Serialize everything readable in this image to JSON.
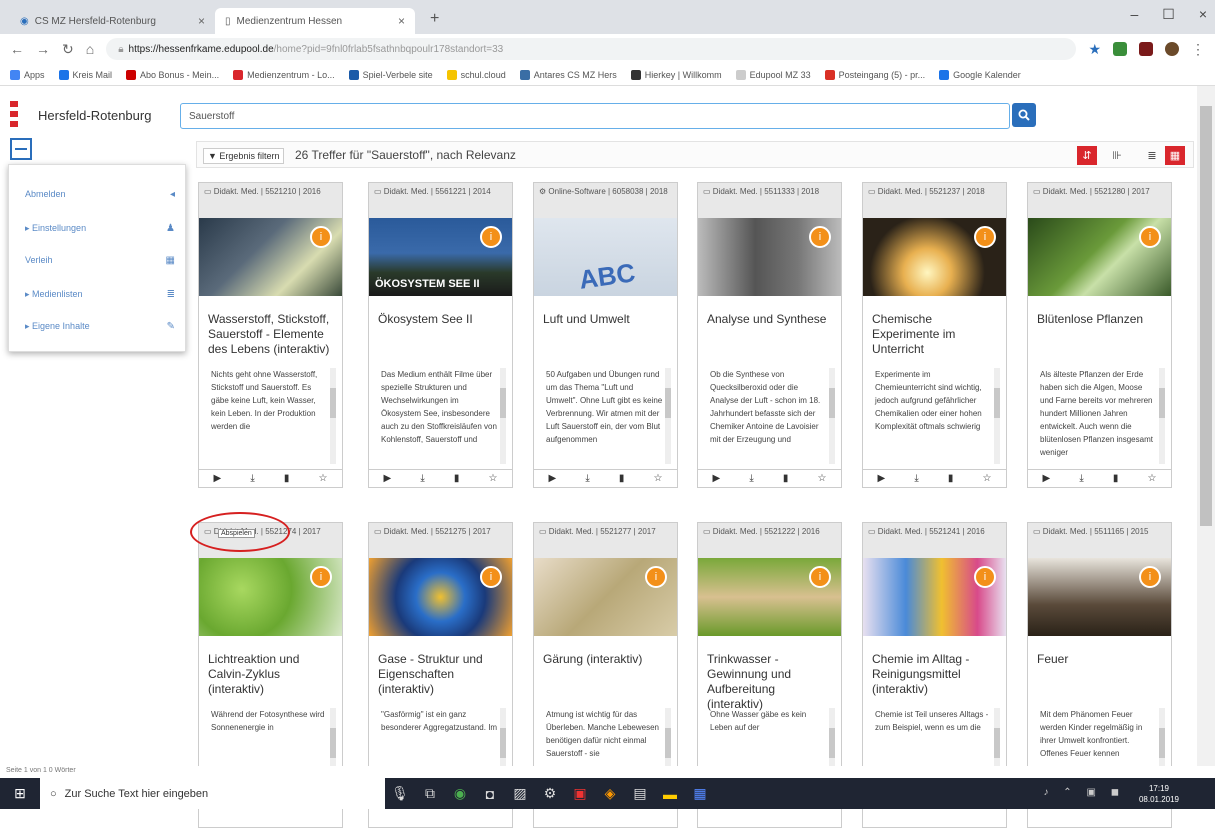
{
  "browser": {
    "tabs": [
      {
        "label": "CS MZ Hersfeld-Rotenburg"
      },
      {
        "label": "Medienzentrum Hessen"
      }
    ],
    "url_host": "https://hessenfrkame.edupool.de",
    "url_rest": "/home?pid=9fnl0frlab5fsathnbqpoulr178standort=33",
    "bookmarks": [
      "Apps",
      "Kreis Mail",
      "Abo Bonus - Mein...",
      "Medienzentrum - Lo...",
      "Spiel-Verbele site",
      "schul.cloud",
      "Antares CS MZ Hers",
      "Hierkey | Willkomm",
      "Edupool MZ 33",
      "Posteingang (5) - pr...",
      "Google Kalender"
    ]
  },
  "header": {
    "region": "Hersfeld-Rotenburg",
    "search_value": "Sauerstoff"
  },
  "sidemenu": [
    {
      "label": "Abmelden",
      "icon": "logout-icon"
    },
    {
      "label": "Einstellungen",
      "icon": "user-icon"
    },
    {
      "label": "Verleih",
      "icon": "calendar-icon"
    },
    {
      "label": "Medienlisten",
      "icon": "list-icon"
    },
    {
      "label": "Eigene Inhalte",
      "icon": "edit-icon"
    }
  ],
  "results": {
    "filter_label": "Ergebnis filtern",
    "summary": "26 Treffer für \"Sauerstoff\", nach Relevanz"
  },
  "cards": [
    {
      "meta": "Didakt. Med. | 5521210 | 2016",
      "title": "Wasserstoff, Stickstoff, Sauerstoff - Elemente des Lebens (interaktiv)",
      "desc": "Nichts geht ohne Wasserstoff, Stickstoff und Sauerstoff. Es gäbe keine Luft, kein Wasser, kein Leben. In der Produktion werden die"
    },
    {
      "meta": "Didakt. Med. | 5561221 | 2014",
      "title": "Ökosystem See II",
      "desc": "Das Medium enthält Filme über spezielle Strukturen und Wechselwirkungen im Ökosystem See, insbesondere auch zu den Stoffkreisläufen von Kohlenstoff, Sauerstoff und"
    },
    {
      "meta": "Online-Software | 6058038 | 2018",
      "title": "Luft und Umwelt",
      "desc": "50 Aufgaben und Übungen rund um das Thema \"Luft und Umwelt\". Ohne Luft gibt es keine Verbrennung. Wir atmen mit der Luft Sauerstoff ein, der vom Blut aufgenommen"
    },
    {
      "meta": "Didakt. Med. | 5511333 | 2018",
      "title": "Analyse und Synthese",
      "desc": "Ob die Synthese von Quecksilberoxid oder die Analyse der Luft - schon im 18. Jahrhundert befasste sich der Chemiker Antoine de Lavoisier mit der Erzeugung und"
    },
    {
      "meta": "Didakt. Med. | 5521237 | 2018",
      "title": "Chemische Experimente im Unterricht",
      "desc": "Experimente im Chemieunterricht sind wichtig, jedoch aufgrund gefährlicher Chemikalien oder einer hohen Komplexität oftmals schwierig"
    },
    {
      "meta": "Didakt. Med. | 5521280 | 2017",
      "title": "Blütenlose Pflanzen",
      "desc": "Als älteste Pflanzen der Erde haben sich die Algen, Moose und Farne bereits vor mehreren hundert Millionen Jahren entwickelt. Auch wenn die blütenlosen Pflanzen insgesamt weniger"
    },
    {
      "meta": "Didakt. Med. | 5521274 | 2017",
      "title": "Lichtreaktion und Calvin-Zyklus (interaktiv)",
      "desc": "Während der Fotosynthese wird Sonnenenergie in"
    },
    {
      "meta": "Didakt. Med. | 5521275 | 2017",
      "title": "Gase - Struktur und Eigenschaften (interaktiv)",
      "desc": "\"Gasförmig\" ist ein ganz besonderer Aggregatzustand. Im"
    },
    {
      "meta": "Didakt. Med. | 5521277 | 2017",
      "title": "Gärung (interaktiv)",
      "desc": "Atmung ist wichtig für das Überleben. Manche Lebewesen benötigen dafür nicht einmal Sauerstoff - sie"
    },
    {
      "meta": "Didakt. Med. | 5521222 | 2016",
      "title": "Trinkwasser - Gewinnung und Aufbereitung (interaktiv)",
      "desc": "Ohne Wasser gäbe es kein Leben auf der"
    },
    {
      "meta": "Didakt. Med. | 5521241 | 2016",
      "title": "Chemie im Alltag - Reinigungsmittel (interaktiv)",
      "desc": "Chemie ist Teil unseres Alltags - zum Beispiel, wenn es um die"
    },
    {
      "meta": "Didakt. Med. | 5511165 | 2015",
      "title": "Feuer",
      "desc": "Mit dem Phänomen Feuer werden Kinder regelmäßig in ihrer Umwelt konfrontiert. Offenes Feuer kennen"
    }
  ],
  "card_overlay_text": "ÖKOSYSTEM SEE II",
  "card_abc_text": "ABC",
  "tooltip": "Abspielen",
  "statusbar": "Seite 1 von 1    0 Wörter",
  "taskbar": {
    "search_placeholder": "Zur Suche Text hier eingeben",
    "time": "17:19",
    "date": "08.01.2019"
  },
  "colors": {
    "accent": "#2a6ebb",
    "badge": "#f39019",
    "brand_red": "#d9262c"
  }
}
